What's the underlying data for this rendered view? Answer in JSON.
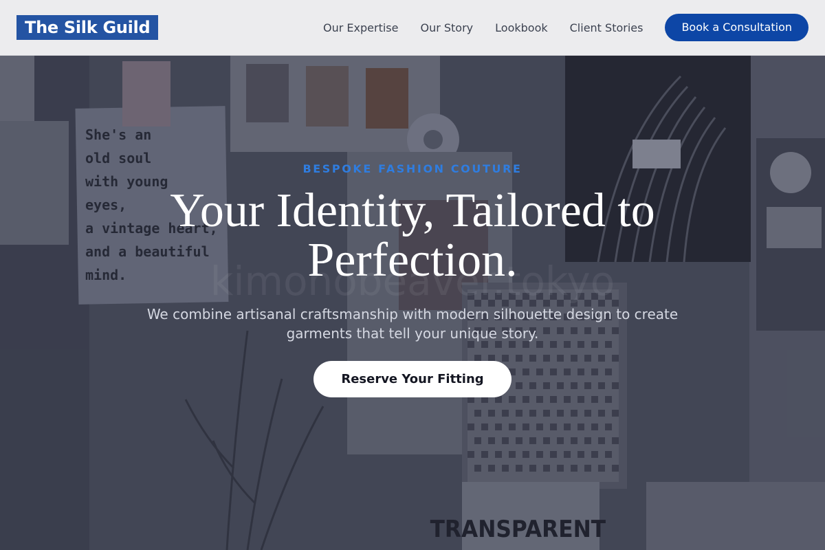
{
  "header": {
    "logo": "The Silk Guild",
    "nav": [
      "Our Expertise",
      "Our Story",
      "Lookbook",
      "Client Stories"
    ],
    "cta": "Book a Consultation"
  },
  "hero": {
    "eyebrow": "BESPOKE FASHION COUTURE",
    "headline": "Your Identity, Tailored to Perfection.",
    "subheadline": "We combine artisanal craftsmanship with modern silhouette design to create garments that tell your unique story.",
    "button": "Reserve Your Fitting",
    "background": {
      "note_text": [
        "She's an",
        "old soul",
        "with young",
        "eyes,",
        "a vintage heart,",
        "and a beautiful",
        "mind."
      ],
      "watermark": "kimonobeaver.tokyo",
      "card_label": "TRANSPARENT"
    }
  },
  "colors": {
    "brand": "#2454a3",
    "cta": "#0d46a6",
    "eyebrow": "#2f7de0"
  }
}
